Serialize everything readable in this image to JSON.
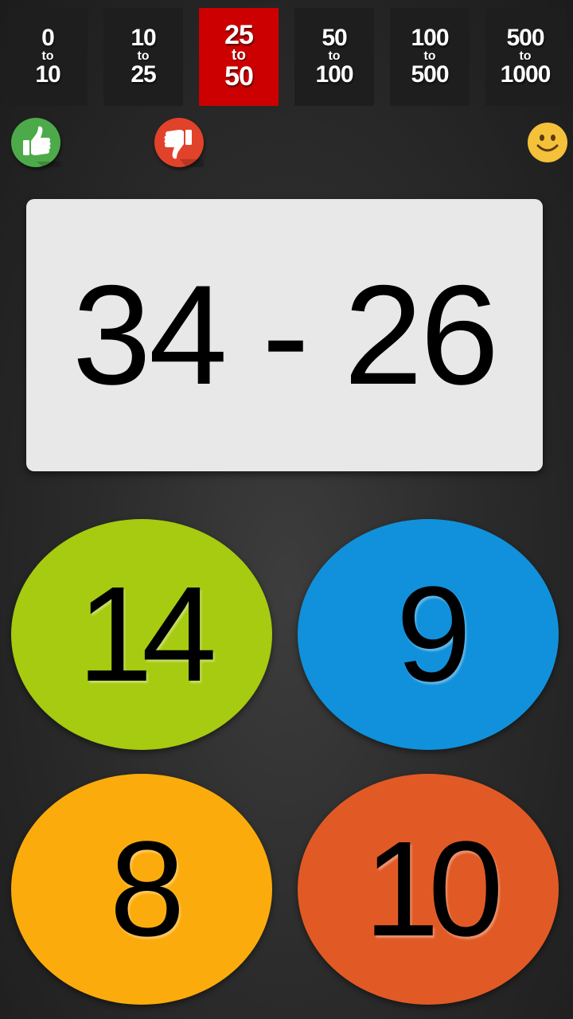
{
  "ranges": [
    {
      "from": "0",
      "to_word": "to",
      "to": "10"
    },
    {
      "from": "10",
      "to_word": "to",
      "to": "25"
    },
    {
      "from": "25",
      "to_word": "to",
      "to": "50"
    },
    {
      "from": "50",
      "to_word": "to",
      "to": "100"
    },
    {
      "from": "100",
      "to_word": "to",
      "to": "500"
    },
    {
      "from": "500",
      "to_word": "to",
      "to": "1000"
    }
  ],
  "active_range_index": 2,
  "colors": {
    "active_range": "#cc0000",
    "thumbs_up": "#4caa4a",
    "thumbs_down": "#e1422a",
    "smiley": "#f5c13a",
    "answer_green": "#a6cb10",
    "answer_blue": "#1191db",
    "answer_orange": "#fbac0c",
    "answer_red": "#e15a25"
  },
  "icons": {
    "correct": "thumbs-up-icon",
    "wrong": "thumbs-down-icon",
    "mood": "smiley-icon"
  },
  "problem": {
    "text": "34 - 26"
  },
  "answers": [
    "14",
    "9",
    "8",
    "10"
  ]
}
